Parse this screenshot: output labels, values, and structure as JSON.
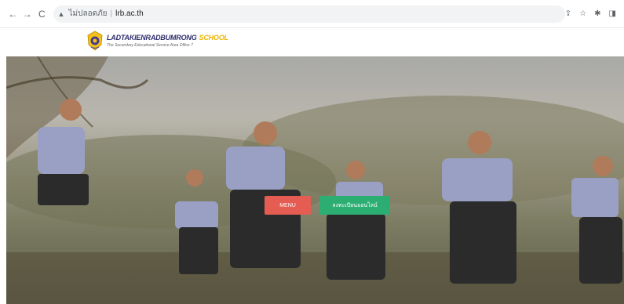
{
  "browser": {
    "security_label": "ไม่ปลอดภัย",
    "url": "lrb.ac.th",
    "icons": [
      "back-arrow",
      "forward-arrow",
      "reload",
      "share",
      "star",
      "extensions",
      "sidebar"
    ]
  },
  "header": {
    "title_main": "LADTAKIENRADBUMRONG",
    "title_accent": "SCHOOL",
    "subtitle": "The Secondary Educational Service Area Office 7"
  },
  "hero": {
    "menu_label": "MENU",
    "online_label": "ลงทะเบียนออนไลน์"
  },
  "colors": {
    "menu_button": "#e45c52",
    "online_button": "#2cae73",
    "title_main": "#2e2e6e",
    "title_accent": "#f0b400"
  }
}
